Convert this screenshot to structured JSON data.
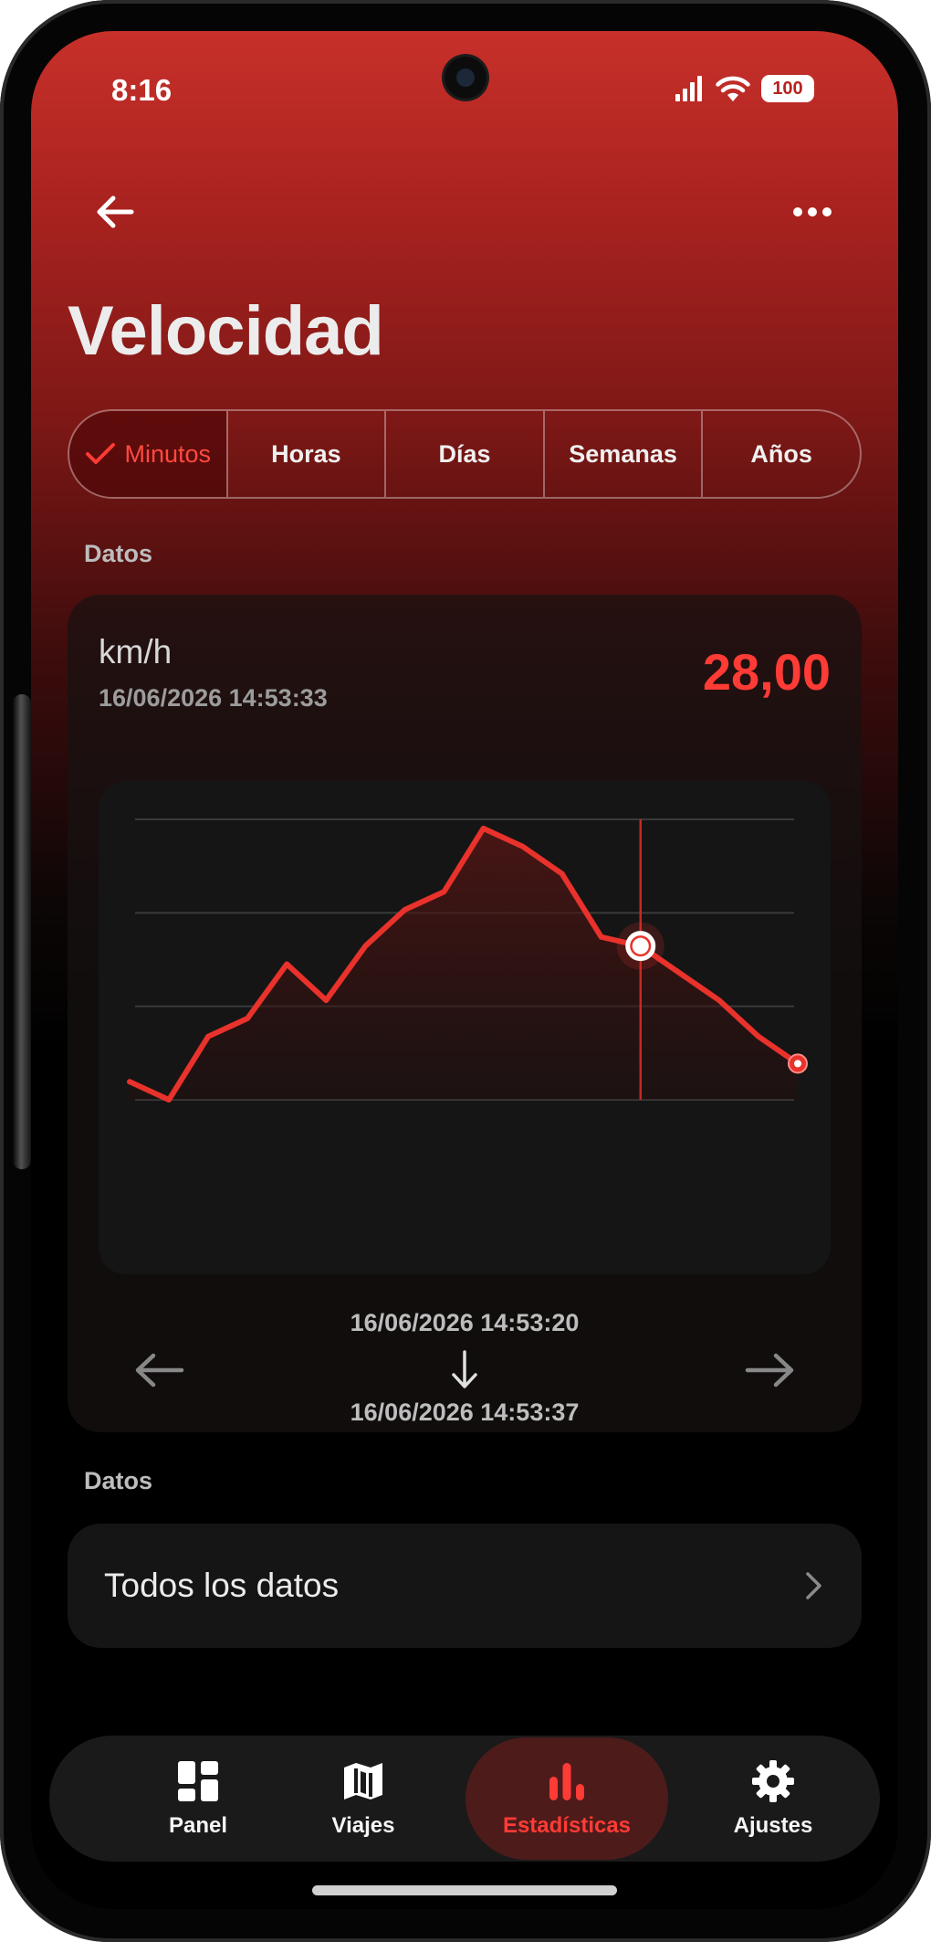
{
  "status": {
    "time": "8:16",
    "battery": "100"
  },
  "header": {
    "title": "Velocidad"
  },
  "segments": [
    {
      "label": "Minutos",
      "active": true
    },
    {
      "label": "Horas",
      "active": false
    },
    {
      "label": "Días",
      "active": false
    },
    {
      "label": "Semanas",
      "active": false
    },
    {
      "label": "Años",
      "active": false
    }
  ],
  "data_section": {
    "label": "Datos",
    "unit": "km/h",
    "timestamp": "16/06/2026 14:53:33",
    "value": "28,00",
    "range_start": "16/06/2026 14:53:20",
    "range_end": "16/06/2026 14:53:37"
  },
  "chart_data": {
    "type": "area",
    "x": [
      "14:53:20",
      "14:53:21",
      "14:53:22",
      "14:53:23",
      "14:53:24",
      "14:53:25",
      "14:53:26",
      "14:53:27",
      "14:53:28",
      "14:53:29",
      "14:53:30",
      "14:53:31",
      "14:53:32",
      "14:53:33",
      "14:53:34",
      "14:53:35",
      "14:53:36",
      "14:53:37"
    ],
    "values": [
      2,
      0,
      7,
      9,
      15,
      11,
      17,
      21,
      23,
      30,
      28,
      25,
      18,
      17,
      14,
      11,
      7,
      4
    ],
    "ylim": [
      0,
      31
    ],
    "grid": true,
    "selected_index": 13,
    "colors": {
      "line": "#e8322b",
      "marker": "#ffffff",
      "grid": "#3a3a3a",
      "cursor": "#c62a24"
    }
  },
  "list_section": {
    "label": "Datos",
    "items": [
      {
        "label": "Todos los datos"
      }
    ]
  },
  "bottom_nav": [
    {
      "label": "Panel",
      "icon": "dashboard-icon",
      "active": false
    },
    {
      "label": "Viajes",
      "icon": "map-icon",
      "active": false
    },
    {
      "label": "Estadísticas",
      "icon": "bar-chart-icon",
      "active": true
    },
    {
      "label": "Ajustes",
      "icon": "gear-icon",
      "active": false
    }
  ],
  "theme": {
    "accent": "#ff3b35",
    "gradient_top": "#c8302a",
    "background": "#000000"
  }
}
